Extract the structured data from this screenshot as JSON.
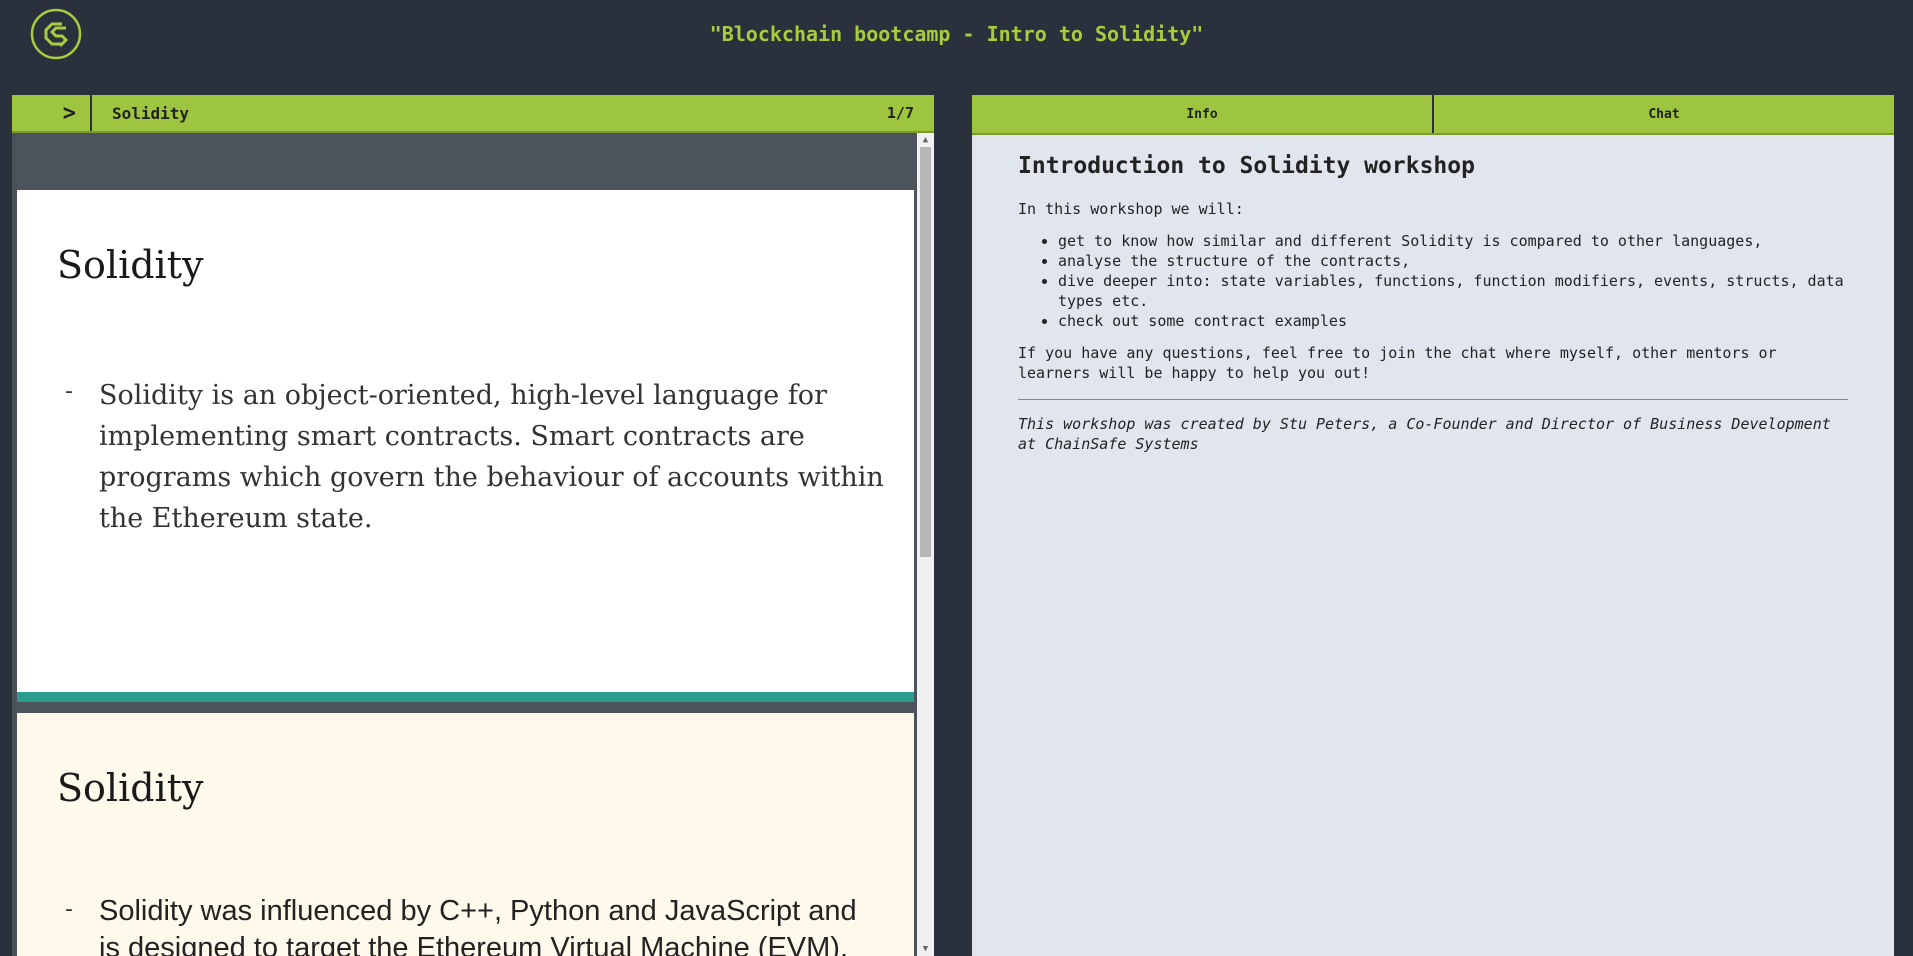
{
  "header": {
    "title": "\"Blockchain bootcamp - Intro to Solidity\"",
    "logo": "chainsafe-logo-icon",
    "accent_color": "#a7cc3f"
  },
  "left_panel": {
    "toggle_label": ">",
    "document_title": "Solidity",
    "page_indicator": "1/7",
    "slides": [
      {
        "title": "Solidity",
        "bullet_marker": "-",
        "bullet_text": "Solidity is an object-oriented, high-level language for implementing smart contracts. Smart contracts are programs which govern the behaviour of accounts within the Ethereum state."
      },
      {
        "title": "Solidity",
        "bullet_marker": "-",
        "bullet_text": "Solidity was influenced by C++, Python and JavaScript and is designed to target the Ethereum Virtual Machine (EVM)."
      }
    ]
  },
  "right_panel": {
    "tabs": [
      {
        "label": "Info"
      },
      {
        "label": "Chat"
      }
    ],
    "info": {
      "heading": "Introduction to Solidity workshop",
      "intro": "In this workshop we will:",
      "items": [
        "get to know how similar and different Solidity is compared to other languages,",
        "analyse the structure of the contracts,",
        "dive deeper into: state variables, functions, function modifiers, events, structs, data types etc.",
        "check out some contract examples"
      ],
      "questions": "If you have any questions, feel free to join the chat where myself, other mentors or learners will be happy to help you out!",
      "credit": "This workshop was created by Stu Peters, a Co-Founder and Director of Business Development at ChainSafe Systems"
    }
  }
}
